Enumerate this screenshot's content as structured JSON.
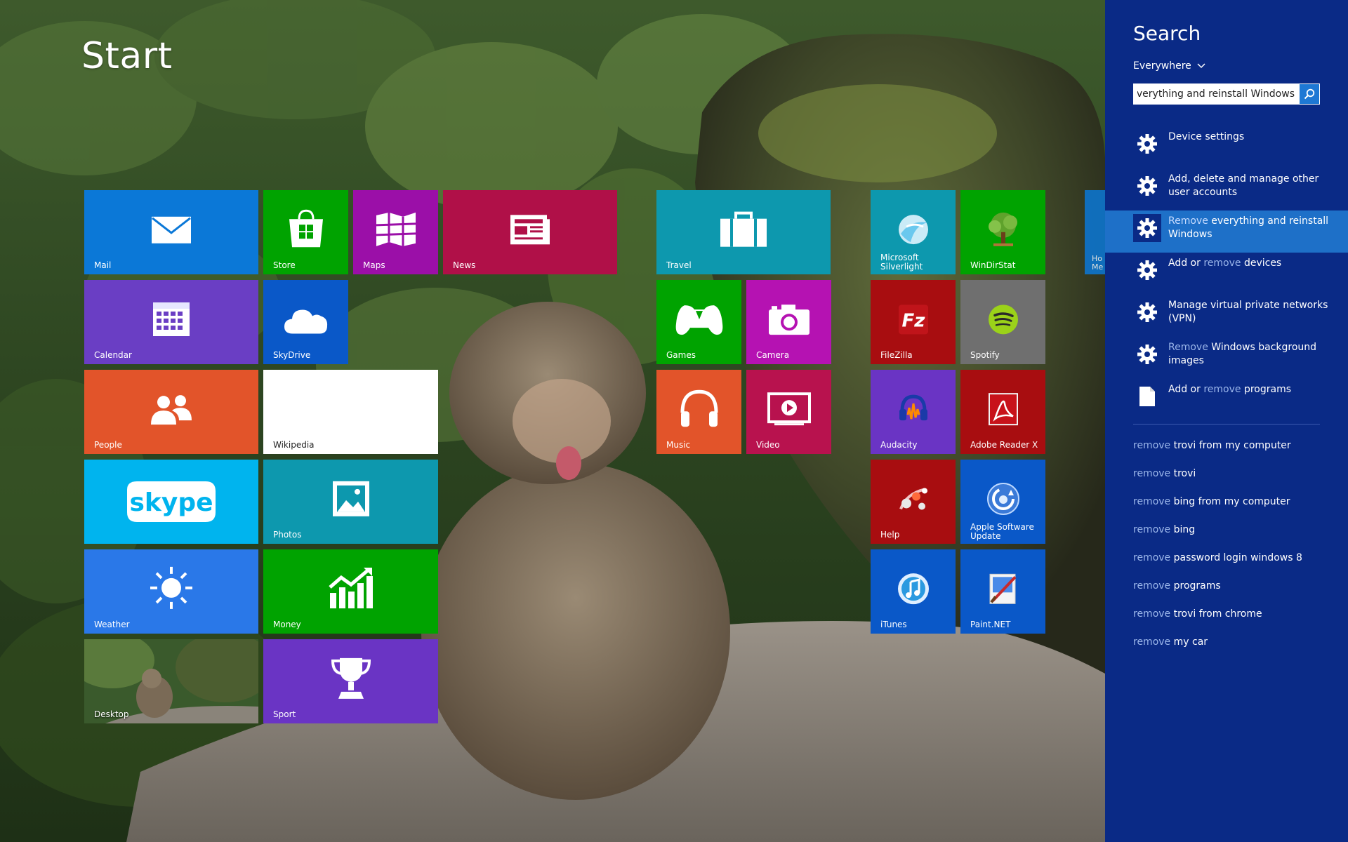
{
  "start": {
    "title": "Start"
  },
  "tiles": [
    {
      "id": "mail",
      "label": "Mail",
      "color": "#0b78d7",
      "icon": "mail-icon"
    },
    {
      "id": "store",
      "label": "Store",
      "color": "#00a300",
      "icon": "store-icon"
    },
    {
      "id": "maps",
      "label": "Maps",
      "color": "#9b0fa8",
      "icon": "maps-icon"
    },
    {
      "id": "news",
      "label": "News",
      "color": "#b01048",
      "icon": "news-icon"
    },
    {
      "id": "calendar",
      "label": "Calendar",
      "color": "#6a3ec4",
      "icon": "calendar-icon"
    },
    {
      "id": "skydrive",
      "label": "SkyDrive",
      "color": "#0a58c8",
      "icon": "cloud-icon"
    },
    {
      "id": "people",
      "label": "People",
      "color": "#e2542a",
      "icon": "people-icon"
    },
    {
      "id": "wikipedia",
      "label": "Wikipedia",
      "color": "#ffffff",
      "icon": ""
    },
    {
      "id": "skype",
      "label": "",
      "color": "#00b4ee",
      "icon": "skype-icon"
    },
    {
      "id": "photos",
      "label": "Photos",
      "color": "#0d98ae",
      "icon": "photos-icon"
    },
    {
      "id": "weather",
      "label": "Weather",
      "color": "#2a78e8",
      "icon": "sun-icon"
    },
    {
      "id": "money",
      "label": "Money",
      "color": "#00a300",
      "icon": "chart-up-icon"
    },
    {
      "id": "desktop",
      "label": "Desktop",
      "color": "#2e4a2a",
      "icon": ""
    },
    {
      "id": "sport",
      "label": "Sport",
      "color": "#6a34c4",
      "icon": "trophy-icon"
    },
    {
      "id": "travel",
      "label": "Travel",
      "color": "#0d98ae",
      "icon": "suitcase-icon"
    },
    {
      "id": "games",
      "label": "Games",
      "color": "#00a300",
      "icon": "gamepad-icon"
    },
    {
      "id": "camera",
      "label": "Camera",
      "color": "#b512b2",
      "icon": "camera-icon"
    },
    {
      "id": "music",
      "label": "Music",
      "color": "#e2542a",
      "icon": "headphones-icon"
    },
    {
      "id": "video",
      "label": "Video",
      "color": "#b8124e",
      "icon": "video-icon"
    },
    {
      "id": "silverlight",
      "label": "Microsoft Silverlight",
      "color": "#0d98ae",
      "icon": "silverlight-icon"
    },
    {
      "id": "windirstat",
      "label": "WinDirStat",
      "color": "#00a300",
      "icon": "tree-icon"
    },
    {
      "id": "filezilla",
      "label": "FileZilla",
      "color": "#a80d10",
      "icon": "filezilla-icon"
    },
    {
      "id": "spotify",
      "label": "Spotify",
      "color": "#6f6f6f",
      "icon": "spotify-icon"
    },
    {
      "id": "audacity",
      "label": "Audacity",
      "color": "#6a34c4",
      "icon": "audacity-icon"
    },
    {
      "id": "adobe",
      "label": "Adobe Reader X",
      "color": "#a80d10",
      "icon": "pdf-icon"
    },
    {
      "id": "help",
      "label": "Help",
      "color": "#a80d10",
      "icon": "help-icon"
    },
    {
      "id": "applesu",
      "label": "Apple Software Update",
      "color": "#0a58c8",
      "icon": "apple-update-icon"
    },
    {
      "id": "itunes",
      "label": "iTunes",
      "color": "#0a58c8",
      "icon": "itunes-icon"
    },
    {
      "id": "paintnet",
      "label": "Paint.NET",
      "color": "#0a58c8",
      "icon": "paintnet-icon"
    },
    {
      "id": "partial",
      "label": "Ho Me",
      "color": "#0b78d7",
      "icon": ""
    }
  ],
  "search": {
    "title": "Search",
    "scope": "Everywhere",
    "query": "Remove everything and reinstall Windows",
    "pane_color": "#0a2a86",
    "selected_color": "#1e70c8",
    "results": [
      {
        "icon": "gear-icon",
        "parts": [
          {
            "t": "Device settings",
            "hl": false
          }
        ]
      },
      {
        "icon": "gear-icon",
        "parts": [
          {
            "t": "Add, delete and manage other user accounts",
            "hl": false
          }
        ]
      },
      {
        "icon": "gear-icon",
        "selected": true,
        "parts": [
          {
            "t": "Remove",
            "hl": true
          },
          {
            "t": " everything and reinstall Windows",
            "hl": false
          }
        ]
      },
      {
        "icon": "gear-icon",
        "parts": [
          {
            "t": "Add or ",
            "hl": false
          },
          {
            "t": "remove",
            "hl": true
          },
          {
            "t": " devices",
            "hl": false
          }
        ]
      },
      {
        "icon": "gear-icon",
        "parts": [
          {
            "t": "Manage virtual private networks (VPN)",
            "hl": false
          }
        ]
      },
      {
        "icon": "gear-icon",
        "parts": [
          {
            "t": "Remove",
            "hl": true
          },
          {
            "t": " Windows background images",
            "hl": false
          }
        ]
      },
      {
        "icon": "document-icon",
        "parts": [
          {
            "t": "Add or ",
            "hl": false
          },
          {
            "t": "remove",
            "hl": true
          },
          {
            "t": " programs",
            "hl": false
          }
        ]
      }
    ],
    "suggestions": [
      {
        "prefix": "remove",
        "rest": " trovi from my computer"
      },
      {
        "prefix": "remove",
        "rest": " trovi"
      },
      {
        "prefix": "remove",
        "rest": " bing from my computer"
      },
      {
        "prefix": "remove",
        "rest": " bing"
      },
      {
        "prefix": "remove",
        "rest": " password login windows 8"
      },
      {
        "prefix": "remove",
        "rest": " programs"
      },
      {
        "prefix": "remove",
        "rest": " trovi from chrome"
      },
      {
        "prefix": "remove",
        "rest": " my car"
      }
    ]
  }
}
